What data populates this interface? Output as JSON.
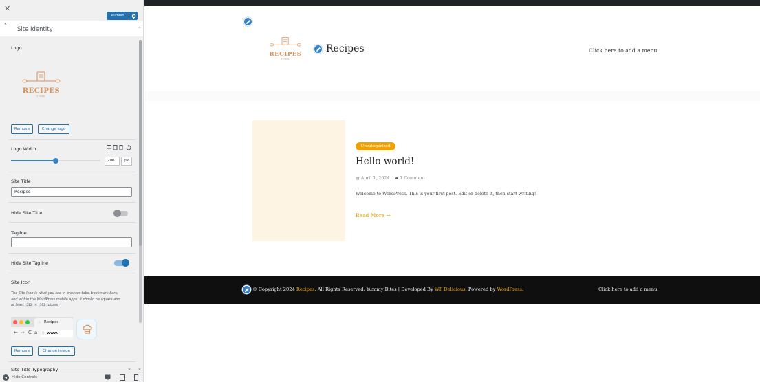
{
  "sidebar": {
    "close_icon": "close-icon",
    "publish_label": "Publish",
    "section_title": "Site Identity",
    "logo_label": "Logo",
    "remove_label": "Remove",
    "change_logo_label": "Change logo",
    "logo_width_label": "Logo Width",
    "logo_width_value": "200",
    "logo_width_unit": "px",
    "logo_width_slider_fraction": 0.5,
    "site_title_label": "Site Title",
    "site_title_value": "Recipes",
    "hide_site_title_label": "Hide Site Title",
    "hide_site_title_on": false,
    "tagline_label": "Tagline",
    "tagline_value": "",
    "hide_tagline_label": "Hide Site Tagline",
    "hide_tagline_on": true,
    "site_icon_label": "Site Icon",
    "site_icon_desc_1": "The Site Icon is what you see in browser tabs, bookmark bars,",
    "site_icon_desc_2": "and within the WordPress mobile apps. It should be square and",
    "site_icon_desc_3a": "at least ",
    "site_icon_desc_size1": "512",
    "site_icon_desc_x": "×",
    "site_icon_desc_size2": "512",
    "site_icon_desc_3b": " pixels.",
    "browser_tab_label": "Recipes",
    "browser_url": "www.",
    "remove_icon_label": "Remove",
    "change_image_label": "Change image",
    "typography_label": "Site Title Typography",
    "hide_controls_label": "Hide Controls"
  },
  "logo": {
    "word": "RECIPES",
    "sub": "FOOD"
  },
  "preview": {
    "site_title": "Recipes",
    "header_menu": "Click here to add a menu",
    "category": "Uncategorized",
    "post_title": "Hello world!",
    "post_date": "April 1, 2024",
    "post_comments": "1 Comment",
    "post_excerpt": "Welcome to WordPress. This is your first post. Edit or delete it, then start writing!",
    "read_more": "Read More →",
    "footer_copyright_1": "© Copyright 2024 ",
    "footer_copyright_site": "Recipes",
    "footer_copyright_2": ". All Rights Reserved. Yummy Bites | Developed By ",
    "footer_copyright_dev": "WP Delicious",
    "footer_copyright_3": ". Powered by ",
    "footer_copyright_wp": "WordPress",
    "footer_copyright_4": ".",
    "footer_menu": "Click here to add a menu"
  },
  "colors": {
    "accent": "#2271b1",
    "brand_orange": "#f0a204",
    "logo_orange": "#d9925a",
    "footer_bg": "#0f0f0f"
  }
}
